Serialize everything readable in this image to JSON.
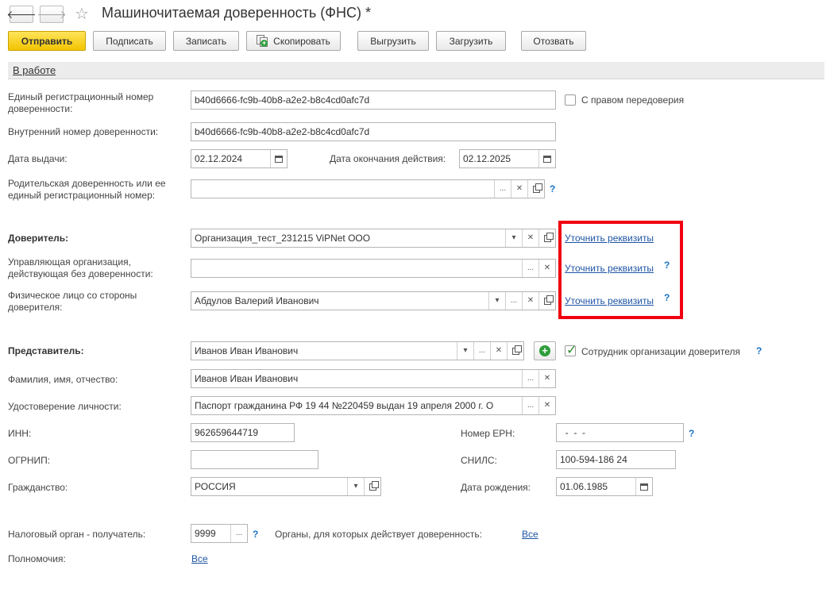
{
  "window": {
    "title": "Машиночитаемая доверенность (ФНС) *"
  },
  "toolbar": {
    "send_label": "Отправить",
    "sign_label": "Подписать",
    "save_label": "Записать",
    "copy_label": "Скопировать",
    "export_label": "Выгрузить",
    "import_label": "Загрузить",
    "revoke_label": "Отозвать"
  },
  "status": {
    "label": "В работе"
  },
  "form": {
    "reg_number_label": "Единый регистрационный номер доверенности:",
    "reg_number_value": "b40d6666-fc9b-40b8-a2e2-b8c4cd0afc7d",
    "redelegation_label": "С правом передоверия",
    "internal_number_label": "Внутренний номер доверенности:",
    "internal_number_value": "b40d6666-fc9b-40b8-a2e2-b8c4cd0afc7d",
    "issue_date_label": "Дата выдачи:",
    "issue_date_value": "02.12.2024",
    "expiry_date_label": "Дата окончания действия:",
    "expiry_date_value": "02.12.2025",
    "parent_label": "Родительская доверенность или ее единый регистрационный номер:",
    "parent_value": "",
    "principal_label": "Доверитель:",
    "principal_value": "Организация_тест_231215 ViPNet ООО",
    "managing_org_label": "Управляющая организация, действующая без доверенности:",
    "managing_org_value": "",
    "individual_label": "Физическое лицо со стороны доверителя:",
    "individual_value": "Абдулов Валерий Иванович",
    "clarify_link": "Уточнить реквизиты",
    "representative_label": "Представитель:",
    "representative_value": "Иванов Иван Иванович",
    "employee_label": "Сотрудник организации доверителя",
    "fio_label": "Фамилия, имя, отчество:",
    "fio_value": "Иванов Иван Иванович",
    "id_doc_label": "Удостоверение личности:",
    "id_doc_value": "Паспорт гражданина РФ 19 44 №220459 выдан 19 апреля 2000 г. О",
    "inn_label": "ИНН:",
    "inn_value": "962659644719",
    "ern_label": "Номер ЕРН:",
    "ern_value": "  -  -  -",
    "ogrnip_label": "ОГРНИП:",
    "ogrnip_value": "",
    "snils_label": "СНИЛС:",
    "snils_value": "100-594-186 24",
    "citizenship_label": "Гражданство:",
    "citizenship_value": "РОССИЯ",
    "birth_date_label": "Дата рождения:",
    "birth_date_value": "01.06.1985",
    "tax_authority_label": "Налоговый орган - получатель:",
    "tax_authority_value": "9999",
    "authorities_label": "Органы, для которых действует доверенность:",
    "authorities_link": "Все",
    "powers_label": "Полномочия:",
    "powers_link": "Все",
    "help_mark": "?"
  },
  "colors": {
    "primary_button": "#f2c400",
    "highlight_box": "#f00010",
    "link": "#1f55a5",
    "check": "#2a8c2a"
  },
  "icons": [
    "back-arrow-icon",
    "forward-arrow-icon",
    "favorite-star-icon",
    "copy-icon",
    "calendar-icon",
    "dropdown-icon",
    "clear-icon",
    "open-icon",
    "select-icon",
    "add-icon",
    "help-icon",
    "checkmark-icon"
  ]
}
